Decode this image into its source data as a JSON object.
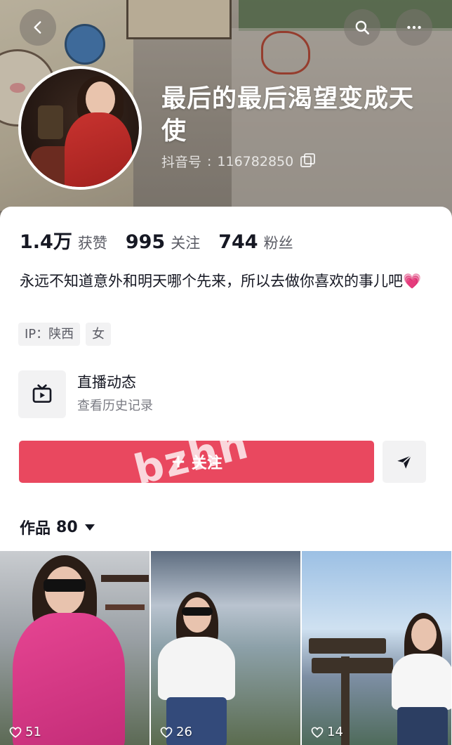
{
  "profile": {
    "nickname": "最后的最后渴望变成天使",
    "douyin_id_label": "抖音号",
    "douyin_id_separator": ":",
    "douyin_id": "116782850"
  },
  "stats": [
    {
      "num": "1.4万",
      "label": "获赞"
    },
    {
      "num": "995",
      "label": "关注"
    },
    {
      "num": "744",
      "label": "粉丝"
    }
  ],
  "bio": {
    "text": "永远不知道意外和明天哪个先来，所以去做你喜欢的事儿吧",
    "emoji": "💗"
  },
  "tags": [
    "IP：陕西",
    "女"
  ],
  "live": {
    "title": "直播动态",
    "subtitle": "查看历史记录"
  },
  "actions": {
    "follow_plus": "+",
    "follow_label": "关注"
  },
  "watermark": "bzhh",
  "works": {
    "label": "作品",
    "count": "80"
  },
  "videos": [
    {
      "likes": "51"
    },
    {
      "likes": "26"
    },
    {
      "likes": "14"
    }
  ],
  "colors": {
    "follow_button": "#e9485f",
    "text_primary": "#161823",
    "tag_bg": "#f2f2f3"
  },
  "icons": {
    "back": "chevron-left-icon",
    "search": "search-icon",
    "more": "more-horizontal-icon",
    "copy": "copy-icon",
    "live": "tv-icon",
    "share": "send-icon",
    "likes": "heart-outline-icon"
  }
}
